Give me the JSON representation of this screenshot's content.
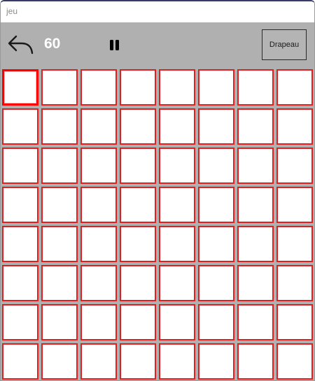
{
  "window": {
    "title": "jeu"
  },
  "toolbar": {
    "back_icon": "undo-arrow-icon",
    "timer_value": "60",
    "pause_icon": "pause-icon",
    "flag_label": "Drapeau"
  },
  "board": {
    "rows": 8,
    "columns": 8,
    "selected_cell": [
      0,
      0
    ],
    "cell_border_color": "#e02020",
    "cell_fill_color": "#ffffff",
    "background_color": "#b0b0b0"
  }
}
